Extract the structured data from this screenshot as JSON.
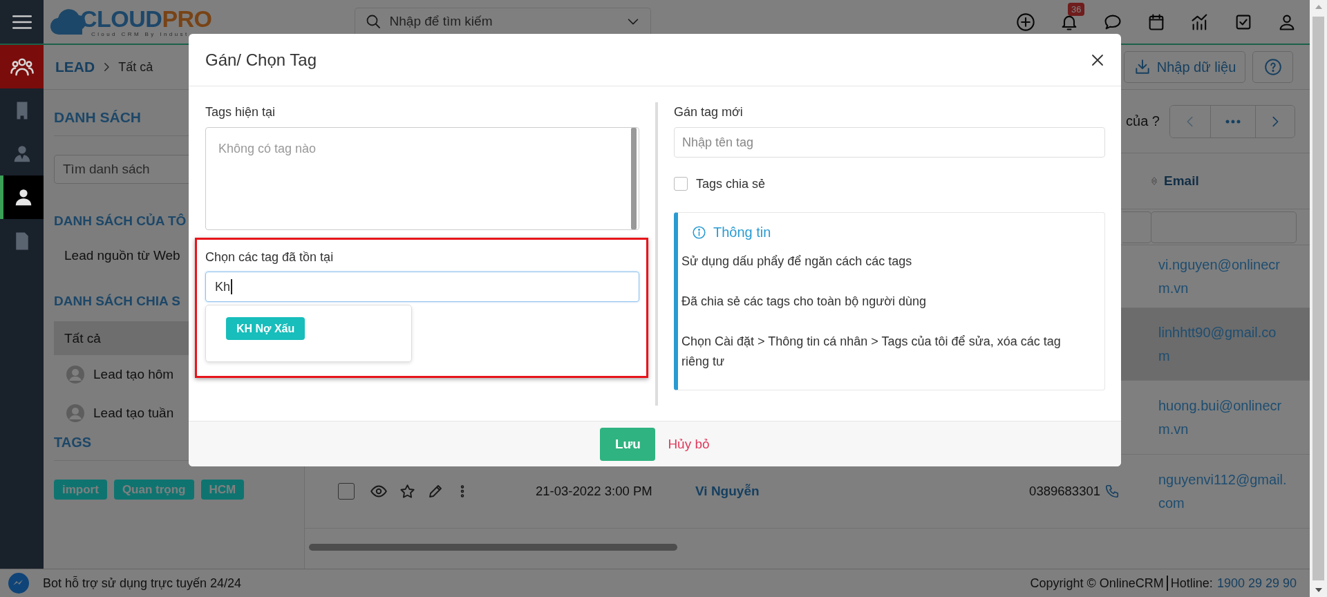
{
  "header": {
    "logo": {
      "brand_main": "CLOUD",
      "brand_accent": "PRO",
      "tagline": "Cloud CRM By Indust"
    },
    "search": {
      "placeholder": "Nhập để tìm kiếm"
    },
    "actions": [
      {
        "kind": "create"
      },
      {
        "kind": "notifications",
        "badge": "36"
      },
      {
        "kind": "chat"
      },
      {
        "kind": "calendar"
      },
      {
        "kind": "reports"
      },
      {
        "kind": "tasks"
      },
      {
        "kind": "account"
      }
    ]
  },
  "rail": {
    "module": {
      "kind": "people"
    },
    "items": [
      {
        "kind": "building",
        "selected": false
      },
      {
        "kind": "agent",
        "selected": false
      },
      {
        "kind": "person",
        "selected": true
      },
      {
        "kind": "document",
        "selected": false
      }
    ]
  },
  "breadcrumb": {
    "module": "LEAD",
    "page": "Tất cả"
  },
  "toolbar": {
    "import_label": "Nhập dữ liệu"
  },
  "sidebar": {
    "title": "DANH SÁCH",
    "search": {
      "placeholder": "Tìm danh sách"
    },
    "sections": [
      {
        "title": "DANH SÁCH CỦA TÔ",
        "items": [
          {
            "label": "Lead nguồn từ Web",
            "avatar": false,
            "selected": false
          }
        ]
      },
      {
        "title": "DANH SÁCH CHIA S",
        "items": [
          {
            "label": "Tất cả",
            "avatar": false,
            "selected": true
          },
          {
            "label": "Lead tạo hôm",
            "avatar": true,
            "selected": false
          },
          {
            "label": "Lead tạo tuần",
            "avatar": true,
            "selected": false
          }
        ]
      }
    ],
    "tags_title": "TAGS",
    "tags": [
      "import",
      "Quan trọng",
      "HCM"
    ]
  },
  "pager": {
    "label": "của ?",
    "prev_disabled": true
  },
  "table": {
    "columns": [
      {
        "label": "Email",
        "sortable": true
      }
    ],
    "rows": [
      {
        "kind": "email_only",
        "email": "vi.nguyen@onlinecrm.vn",
        "highlighted": false
      },
      {
        "kind": "email_only",
        "email": "linhhtt90@gmail.com",
        "highlighted": true
      },
      {
        "kind": "email_only",
        "email": "huong.bui@onlinecrm.vn",
        "highlighted": false
      },
      {
        "kind": "full",
        "date": "21-03-2022 3:00 PM",
        "name": "Vi Nguyễn",
        "phone": "0389683301",
        "email": "nguyenvi112@gmail.com",
        "highlighted": false,
        "checked": false
      }
    ]
  },
  "modal": {
    "title": "Gán/ Chọn Tag",
    "current_tags": {
      "label": "Tags hiện tại",
      "placeholder": "Không có tag nào"
    },
    "existing": {
      "label": "Chọn các tag đã tồn tại",
      "value": "Kh",
      "suggestions": [
        "KH Nợ Xấu"
      ]
    },
    "new_tag": {
      "label": "Gán tag mới",
      "placeholder": "Nhập tên tag"
    },
    "shared": {
      "label": "Tags chia sẻ",
      "checked": false
    },
    "info": {
      "title": "Thông tin",
      "lines": [
        "Sử dụng dấu phẩy để ngăn cách các tags",
        "Đã chia sẻ các tags cho toàn bộ người dùng",
        "Chọn Cài đặt > Thông tin cá nhân > Tags của tôi để sửa, xóa các tag riêng tư"
      ]
    },
    "save": "Lưu",
    "cancel": "Hủy bỏ"
  },
  "status_bar": {
    "bot": "Bot hỗ trợ sử dụng trực tuyến 24/24",
    "copyright": "Copyright © OnlineCRM",
    "hotline_label": "Hotline:",
    "hotline": "1900 29 29 90"
  }
}
